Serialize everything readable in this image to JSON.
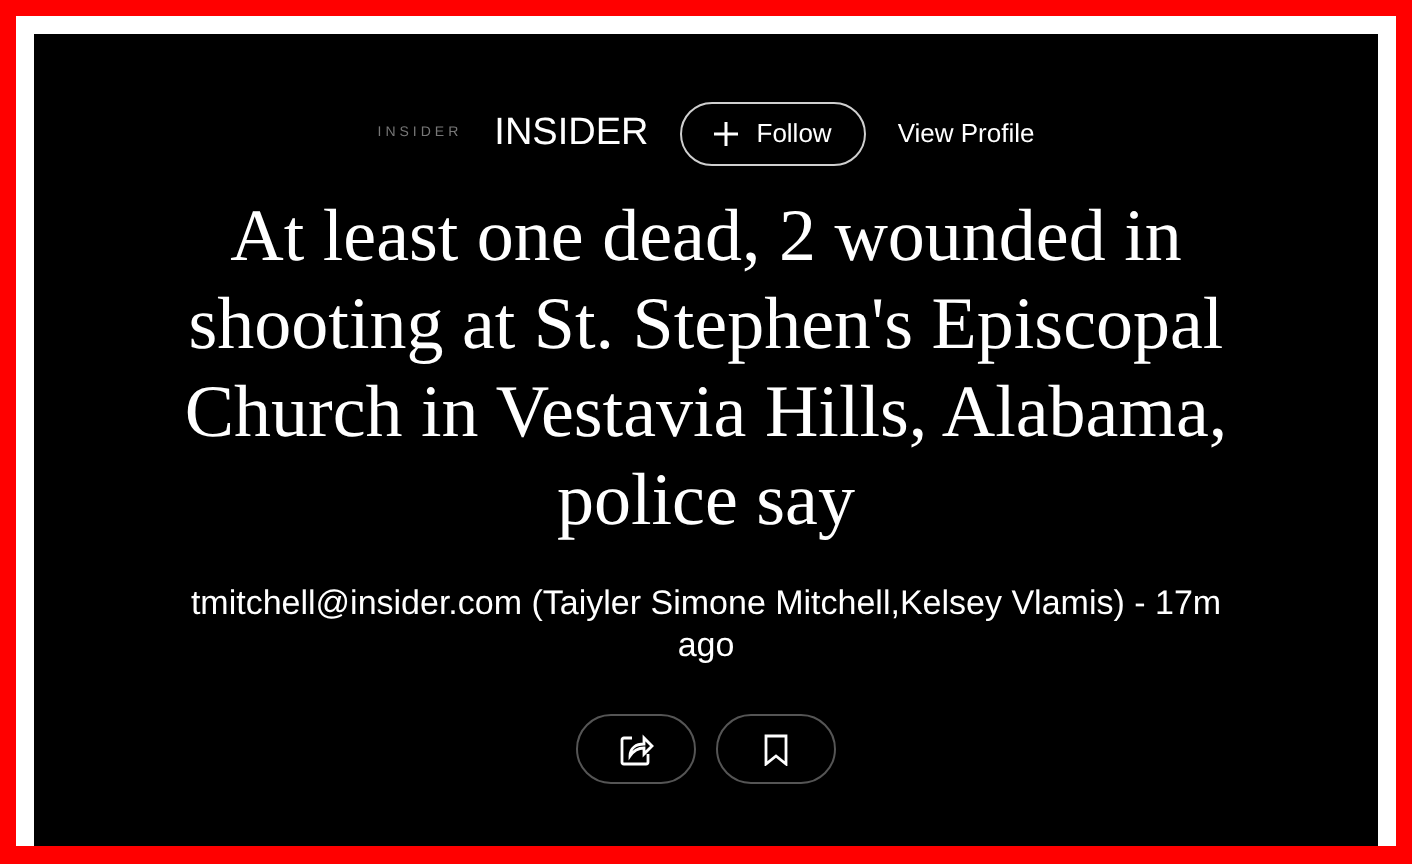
{
  "publisher": {
    "logo_text": "INSIDER",
    "name": "INSIDER",
    "follow_label": "Follow",
    "view_profile": "View Profile"
  },
  "headline": "At least one dead, 2 wounded in shooting at St. Stephen's Episcopal Church in Vestavia Hills, Alabama, police say",
  "byline": "tmitchell@insider.com (Taiyler Simone Mitchell,Kelsey Vlamis) - 17m ago"
}
